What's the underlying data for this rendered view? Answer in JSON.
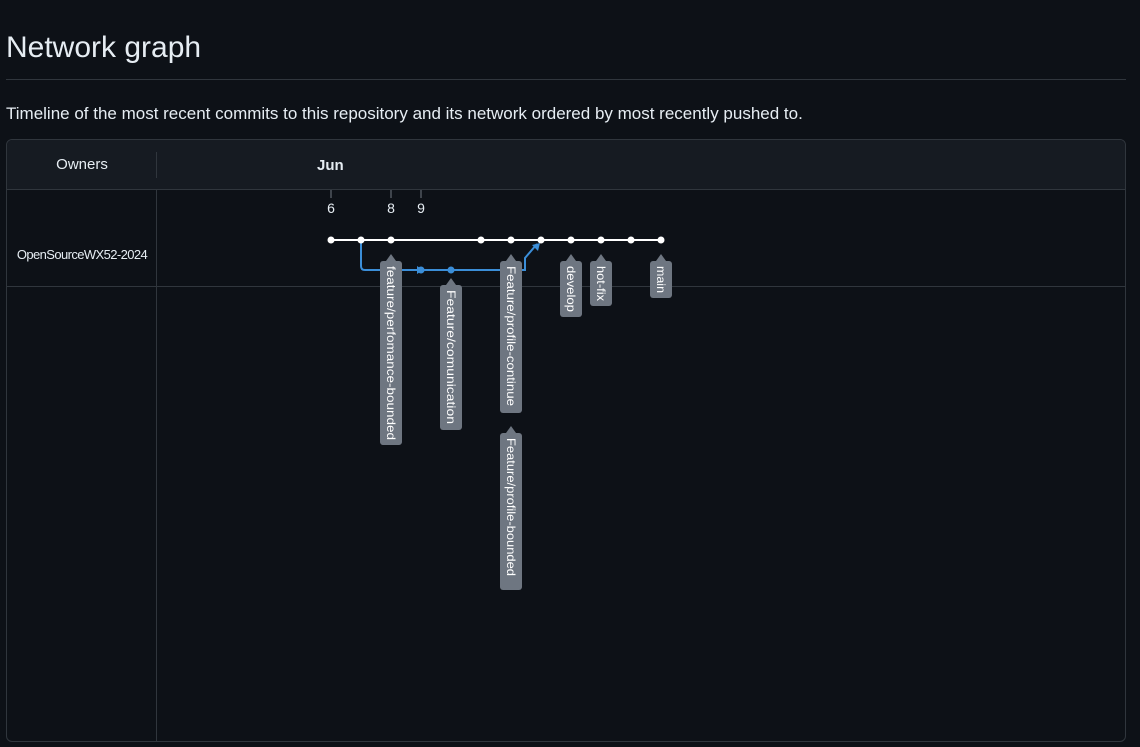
{
  "page": {
    "title": "Network graph",
    "description": "Timeline of the most recent commits to this repository and its network ordered by most recently pushed to."
  },
  "graph": {
    "owners_header": "Owners",
    "month": "Jun",
    "owner": "OpenSourceWX52-2024",
    "days": [
      "6",
      "8",
      "9"
    ],
    "colors": {
      "main_line": "#ffffff",
      "branch_line": "#3b8ed8",
      "label_bg": "#6e7681",
      "label_text": "#ffffff"
    },
    "branches": [
      "feature/perfomance-bounded",
      "Feature/comunication",
      "Feature/profile-continue",
      "Feature/profile-bounded",
      "develop",
      "hot-fix",
      "main"
    ]
  }
}
